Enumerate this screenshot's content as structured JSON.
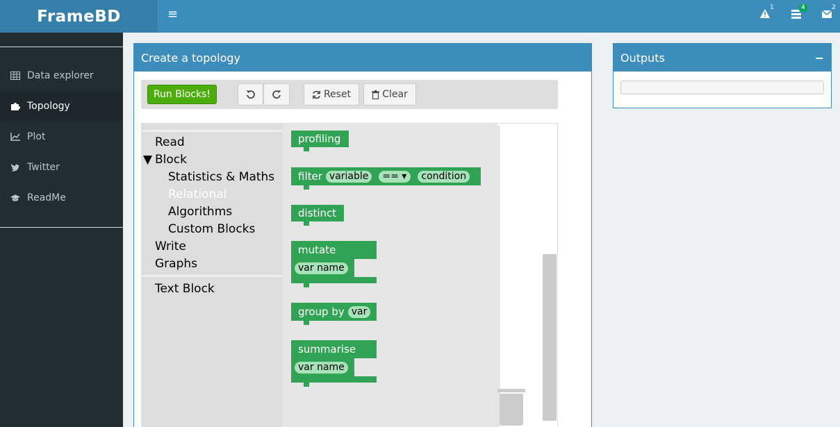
{
  "app": {
    "title": "FrameBD"
  },
  "header": {
    "notifications": [
      {
        "icon": "warning-icon",
        "count": "1",
        "color": "#ffffff"
      },
      {
        "icon": "tasks-icon",
        "count": "4",
        "color": "#00a65a"
      },
      {
        "icon": "envelope-icon",
        "count": "2",
        "color": "#ffffff"
      }
    ]
  },
  "sidebar": {
    "items": [
      {
        "label": "Data explorer",
        "icon": "table-icon"
      },
      {
        "label": "Topology",
        "icon": "puzzle-icon",
        "active": true
      },
      {
        "label": "Plot",
        "icon": "line-chart-icon"
      },
      {
        "label": "Twitter",
        "icon": "twitter-icon"
      },
      {
        "label": "ReadMe",
        "icon": "graduation-cap-icon"
      }
    ]
  },
  "topology": {
    "title": "Create a topology",
    "toolbar": {
      "run_label": "Run Blocks!",
      "reset_label": "Reset",
      "clear_label": "Clear"
    },
    "categories": {
      "read": "Read",
      "block": "Block",
      "block_arrow": "▼",
      "stats": "Statistics & Maths",
      "relational": "Relational",
      "algorithms": "Algorithms",
      "custom": "Custom Blocks",
      "write": "Write",
      "graphs": "Graphs",
      "text": "Text Block"
    },
    "blocks": {
      "profiling": "profiling",
      "filter": "filter",
      "filter_var": "variable",
      "filter_op": "== ▾",
      "filter_cond": "condition",
      "distinct": "distinct",
      "mutate": "mutate",
      "mutate_var": "var name",
      "group_by": "group by",
      "group_var": "var",
      "summarise": "summarise",
      "summarise_var": "var name"
    }
  },
  "outputs": {
    "title": "Outputs",
    "collapse": "−"
  },
  "colors": {
    "brand": "#3c8dbc",
    "sidebar": "#222d32",
    "block": "#31a354",
    "run": "#4cae0c"
  }
}
